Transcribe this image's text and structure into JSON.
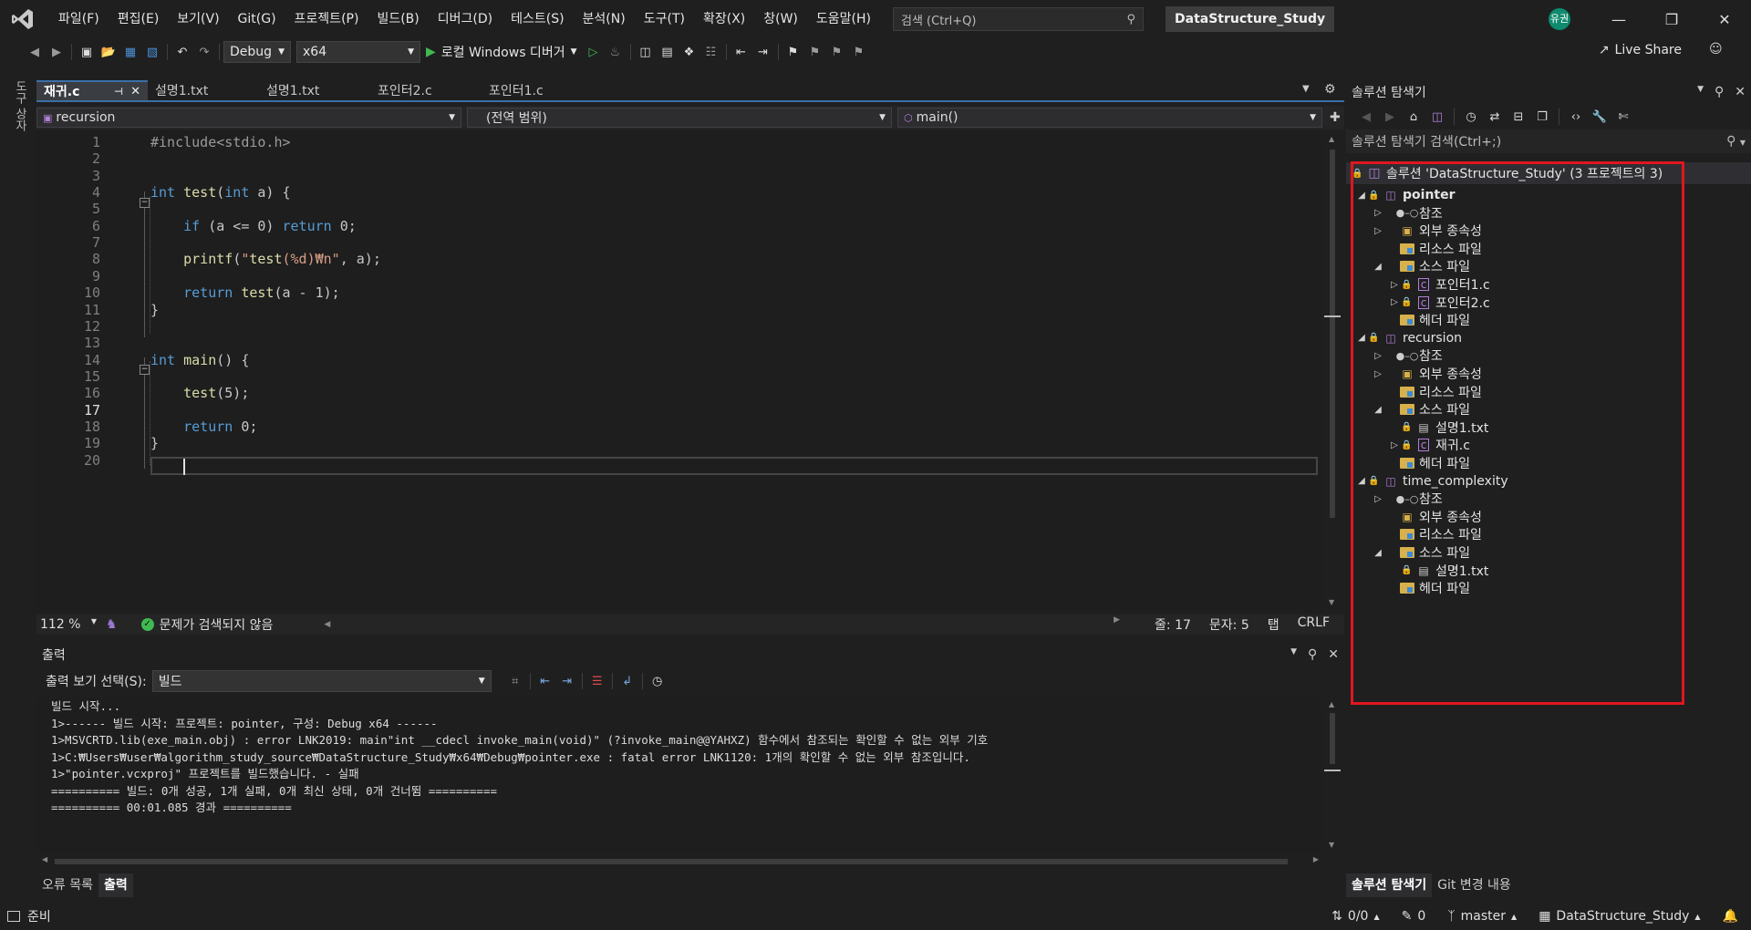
{
  "menubar": {
    "items": [
      "파일(F)",
      "편집(E)",
      "보기(V)",
      "Git(G)",
      "프로젝트(P)",
      "빌드(B)",
      "디버그(D)",
      "테스트(S)",
      "분석(N)",
      "도구(T)",
      "확장(X)",
      "창(W)",
      "도움말(H)"
    ],
    "search_placeholder": "검색 (Ctrl+Q)",
    "solution_name": "DataStructure_Study",
    "avatar_text": "유권"
  },
  "toolbar": {
    "config": "Debug",
    "platform": "x64",
    "debugger_label": "로컬 Windows 디버거",
    "live_share": "Live Share"
  },
  "left_strip": {
    "toolbox_label": "도구 상자"
  },
  "editor": {
    "tabs": [
      "재귀.c",
      "설명1.txt",
      "설명1.txt",
      "포인터2.c",
      "포인터1.c"
    ],
    "active_tab": 0,
    "nav_project": "recursion",
    "nav_scope": "(전역 범위)",
    "nav_member": "main()",
    "current_line": 17,
    "code_lines": [
      {
        "n": "1",
        "text": "#include<stdio.h>"
      },
      {
        "n": "2",
        "text": ""
      },
      {
        "n": "3",
        "text": ""
      },
      {
        "n": "4",
        "text": "int test(int a) {"
      },
      {
        "n": "5",
        "text": ""
      },
      {
        "n": "6",
        "text": "    if (a <= 0) return 0;"
      },
      {
        "n": "7",
        "text": ""
      },
      {
        "n": "8",
        "text": "    printf(\"test(%d)₩n\", a);"
      },
      {
        "n": "9",
        "text": ""
      },
      {
        "n": "10",
        "text": "    return test(a - 1);"
      },
      {
        "n": "11",
        "text": "}"
      },
      {
        "n": "12",
        "text": ""
      },
      {
        "n": "13",
        "text": ""
      },
      {
        "n": "14",
        "text": "int main() {"
      },
      {
        "n": "15",
        "text": ""
      },
      {
        "n": "16",
        "text": "    test(5);"
      },
      {
        "n": "17",
        "text": ""
      },
      {
        "n": "18",
        "text": "    return 0;"
      },
      {
        "n": "19",
        "text": "}"
      },
      {
        "n": "20",
        "text": ""
      }
    ],
    "status": {
      "zoom": "112 %",
      "issues": "문제가 검색되지 않음",
      "line": "줄: 17",
      "col": "문자: 5",
      "indent": "탭",
      "eol": "CRLF"
    }
  },
  "output": {
    "title": "출력",
    "source_label": "출력 보기 선택(S):",
    "source_value": "빌드",
    "lines": [
      "빌드 시작...",
      "1>------ 빌드 시작: 프로젝트: pointer, 구성: Debug x64 ------",
      "1>MSVCRTD.lib(exe_main.obj) : error LNK2019: main\"int __cdecl invoke_main(void)\" (?invoke_main@@YAHXZ) 함수에서 참조되는 확인할 수 없는 외부 기호",
      "1>C:₩Users₩user₩algorithm_study_source₩DataStructure_Study₩x64₩Debug₩pointer.exe : fatal error LNK1120: 1개의 확인할 수 없는 외부 참조입니다.",
      "1>\"pointer.vcxproj\" 프로젝트를 빌드했습니다. - 실패",
      "========== 빌드: 0개 성공, 1개 실패, 0개 최신 상태, 0개 건너뜀 ==========",
      "========== 00:01.085 경과 =========="
    ],
    "bottom_tabs": [
      "오류 목록",
      "출력"
    ]
  },
  "solution_explorer": {
    "title": "솔루션 탐색기",
    "search_placeholder": "솔루션 탐색기 검색(Ctrl+;)",
    "solution_label": "솔루션 'DataStructure_Study'  (3 프로젝트의 3)",
    "tree": [
      {
        "label": "pointer",
        "level": 1,
        "twisty": "open",
        "icon": "project-icon",
        "bold": true
      },
      {
        "label": "참조",
        "level": 2,
        "twisty": "closed",
        "icon": "references-icon"
      },
      {
        "label": "외부 종속성",
        "level": 2,
        "twisty": "closed",
        "icon": "external-deps-icon"
      },
      {
        "label": "리소스 파일",
        "level": 2,
        "twisty": "none",
        "icon": "folder-icon"
      },
      {
        "label": "소스 파일",
        "level": 2,
        "twisty": "open",
        "icon": "folder-icon"
      },
      {
        "label": "포인터1.c",
        "level": 3,
        "twisty": "closed",
        "icon": "c-file-icon",
        "lock": true
      },
      {
        "label": "포인터2.c",
        "level": 3,
        "twisty": "closed",
        "icon": "c-file-icon",
        "lock": true
      },
      {
        "label": "헤더 파일",
        "level": 2,
        "twisty": "none",
        "icon": "folder-icon"
      },
      {
        "label": "recursion",
        "level": 1,
        "twisty": "open",
        "icon": "project-icon"
      },
      {
        "label": "참조",
        "level": 2,
        "twisty": "closed",
        "icon": "references-icon"
      },
      {
        "label": "외부 종속성",
        "level": 2,
        "twisty": "closed",
        "icon": "external-deps-icon"
      },
      {
        "label": "리소스 파일",
        "level": 2,
        "twisty": "none",
        "icon": "folder-icon"
      },
      {
        "label": "소스 파일",
        "level": 2,
        "twisty": "open",
        "icon": "folder-icon"
      },
      {
        "label": "설명1.txt",
        "level": 3,
        "twisty": "none",
        "icon": "text-file-icon",
        "lock": true
      },
      {
        "label": "재귀.c",
        "level": 3,
        "twisty": "closed",
        "icon": "c-file-icon",
        "lock": true
      },
      {
        "label": "헤더 파일",
        "level": 2,
        "twisty": "none",
        "icon": "folder-icon"
      },
      {
        "label": "time_complexity",
        "level": 1,
        "twisty": "open",
        "icon": "project-icon"
      },
      {
        "label": "참조",
        "level": 2,
        "twisty": "closed",
        "icon": "references-icon"
      },
      {
        "label": "외부 종속성",
        "level": 2,
        "twisty": "none",
        "icon": "external-deps-icon"
      },
      {
        "label": "리소스 파일",
        "level": 2,
        "twisty": "none",
        "icon": "folder-icon"
      },
      {
        "label": "소스 파일",
        "level": 2,
        "twisty": "open",
        "icon": "folder-icon"
      },
      {
        "label": "설명1.txt",
        "level": 3,
        "twisty": "none",
        "icon": "text-file-icon",
        "lock": true
      },
      {
        "label": "헤더 파일",
        "level": 2,
        "twisty": "none",
        "icon": "folder-icon"
      }
    ],
    "bottom_tabs": [
      "솔루션 탐색기",
      "Git 변경 내용"
    ]
  },
  "statusbar": {
    "ready": "준비",
    "line_counts": "0/0",
    "edits": "0",
    "branch": "master",
    "solution": "DataStructure_Study"
  },
  "colors": {
    "accent": "#3a6fa8",
    "highlight_box": "#e0161e",
    "keyword": "#569cd6",
    "function": "#dcdcaa"
  }
}
